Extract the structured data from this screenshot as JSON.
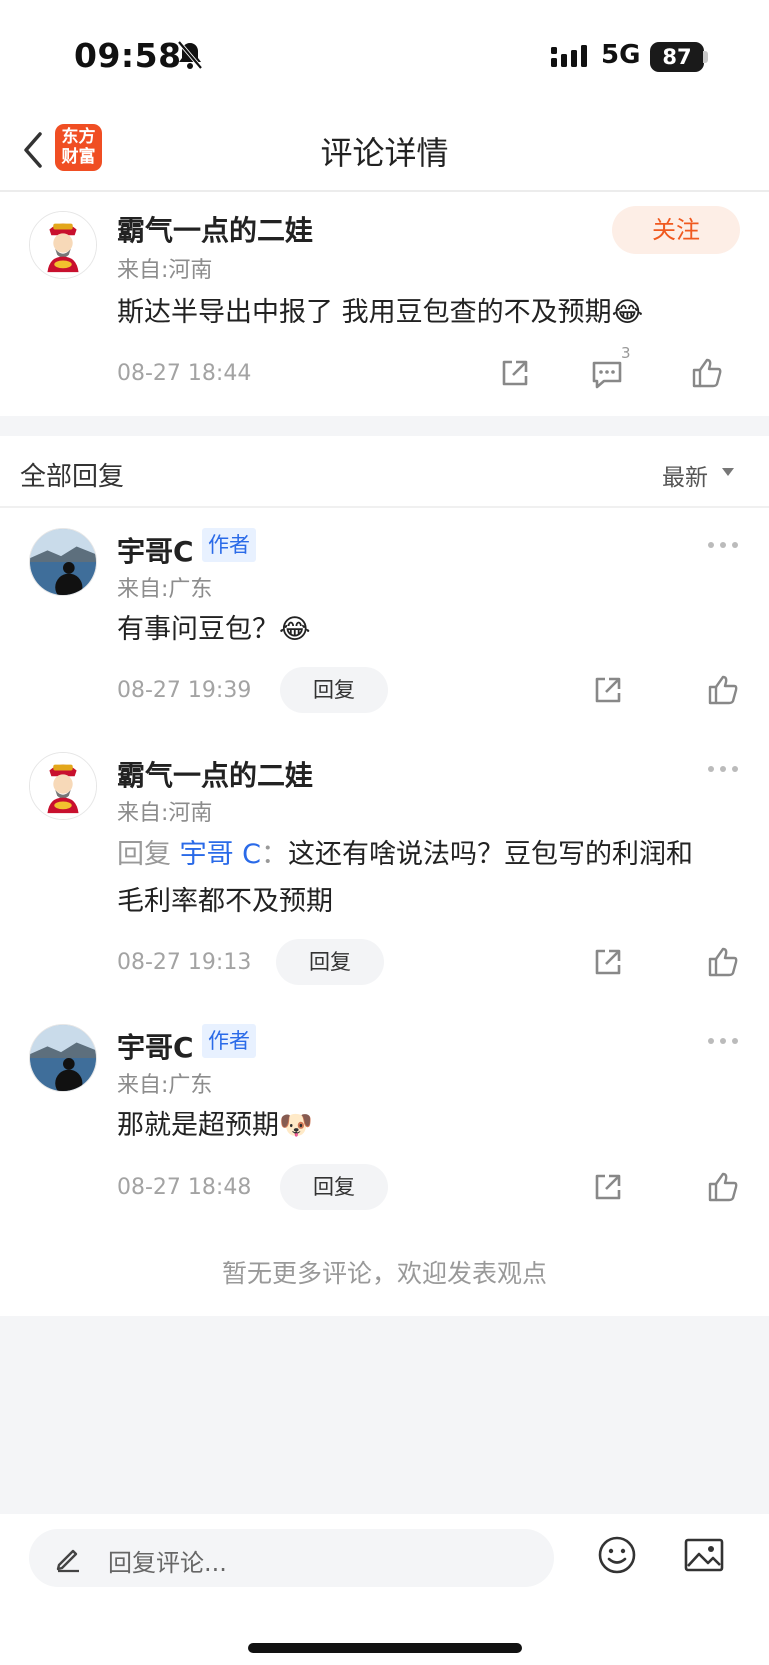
{
  "status_bar": {
    "time": "09:58",
    "network": "5G",
    "battery": "87"
  },
  "nav": {
    "title": "评论详情",
    "logo_line1": "东方",
    "logo_line2": "财富"
  },
  "main_comment": {
    "username": "霸气一点的二娃",
    "region": "来自:河南",
    "follow_label": "关注",
    "content": "斯达半导出中报了  我用豆包查的不及预期😂",
    "time": "08-27 18:44",
    "comment_count": "3"
  },
  "replies_section": {
    "title": "全部回复",
    "sort_label": "最新"
  },
  "replies": [
    {
      "username": "宇哥C",
      "badge": "作者",
      "region": "来自:广东",
      "content": "有事问豆包？😂",
      "time": "08-27 19:39",
      "reply_label": "回复"
    },
    {
      "username": "霸气一点的二娃",
      "region": "来自:河南",
      "reply_prefix": "回复",
      "reply_target": "宇哥 C",
      "reply_sep": "：",
      "content": "这还有啥说法吗？豆包写的利润和",
      "content_line2": "毛利率都不及预期",
      "time": "08-27 19:13",
      "reply_label": "回复"
    },
    {
      "username": "宇哥C",
      "badge": "作者",
      "region": "来自:广东",
      "content": "那就是超预期🐶",
      "time": "08-27 18:48",
      "reply_label": "回复"
    }
  ],
  "footer": {
    "end_text": "暂无更多评论，欢迎发表观点"
  },
  "bottom_bar": {
    "input_placeholder": "回复评论..."
  },
  "colors": {
    "accent": "#f0591f",
    "link_blue": "#2a6ae8",
    "logo_bg": "#f04e23"
  }
}
